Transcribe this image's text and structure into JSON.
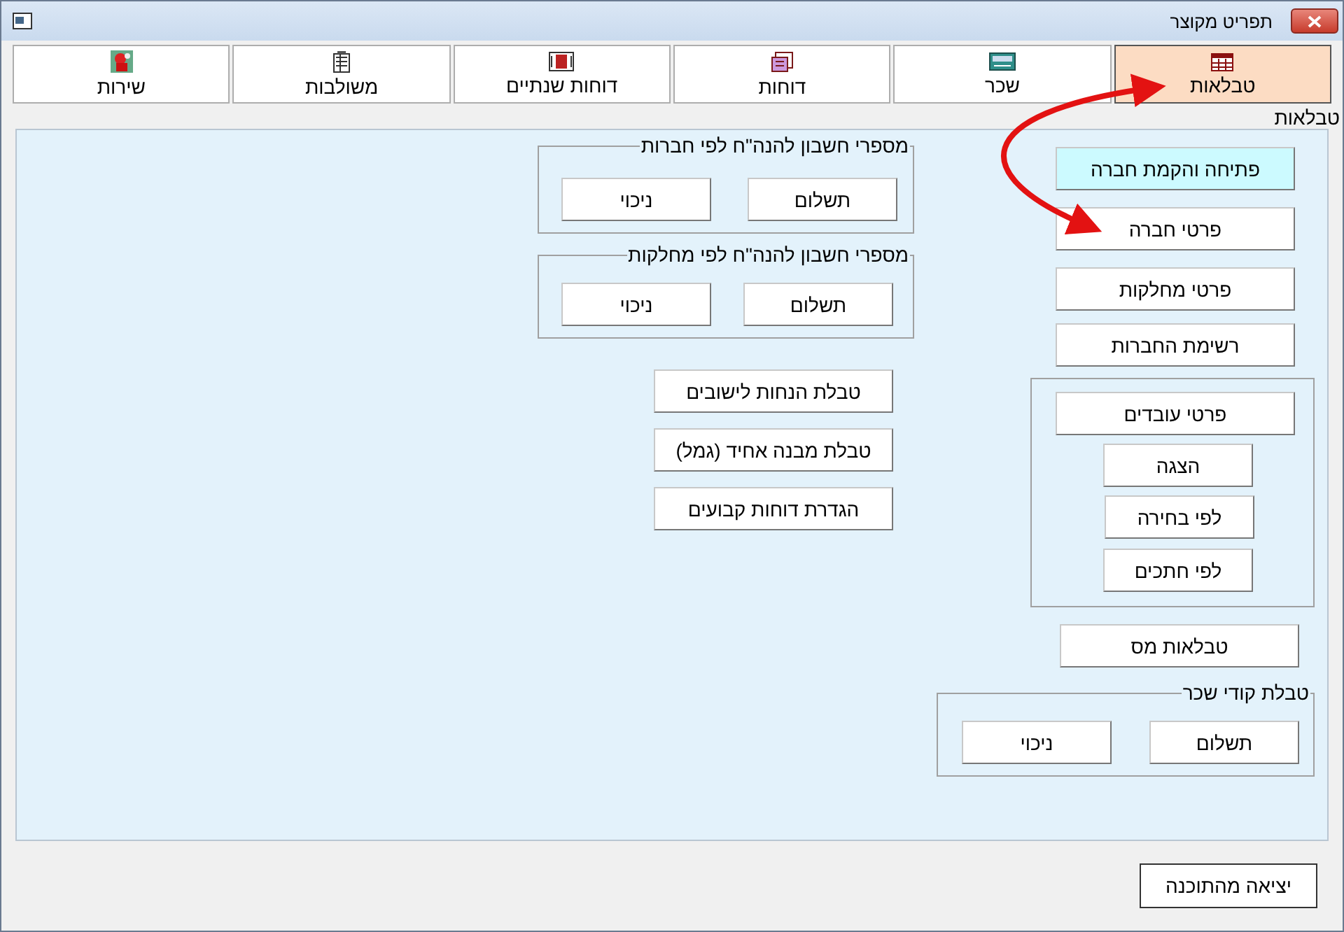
{
  "window": {
    "title": "תפריט מקוצר"
  },
  "tabs": [
    {
      "label": "טבלאות",
      "selected": true
    },
    {
      "label": "שכר",
      "selected": false
    },
    {
      "label": "דוחות",
      "selected": false
    },
    {
      "label": "דוחות שנתיים",
      "selected": false
    },
    {
      "label": "משולבות",
      "selected": false
    },
    {
      "label": "שירות",
      "selected": false
    }
  ],
  "section_label": "טבלאות",
  "buttons": [
    {
      "label": "פתיחה והקמת חברה",
      "highlighted": true
    },
    {
      "label": "פרטי חברה",
      "highlighted": false
    },
    {
      "label": "פרטי מחלקות",
      "highlighted": false
    },
    {
      "label": "רשימת החברות",
      "highlighted": false
    },
    {
      "label": "טבלאות מס",
      "highlighted": false
    },
    {
      "label": "טבלת הנחות לישובים",
      "highlighted": false
    },
    {
      "label": "טבלת מבנה אחיד (גמל)",
      "highlighted": false
    },
    {
      "label": "הגדרת דוחות קבועים",
      "highlighted": false
    }
  ],
  "groups": [
    {
      "buttons": [
        "פרטי עובדים",
        "הצגה",
        "לפי בחירה",
        "לפי חתכים"
      ]
    },
    {
      "title": "טבלת קודי שכר",
      "buttons": [
        "תשלום",
        "ניכוי"
      ]
    },
    {
      "title": "מספרי חשבון להנה\"ח לפי חברות",
      "buttons": [
        "תשלום",
        "ניכוי"
      ]
    },
    {
      "title": "מספרי חשבון להנה\"ח לפי מחלקות",
      "buttons": [
        "תשלום",
        "ניכוי"
      ]
    }
  ],
  "exit_button": "יציאה מהתוכנה"
}
